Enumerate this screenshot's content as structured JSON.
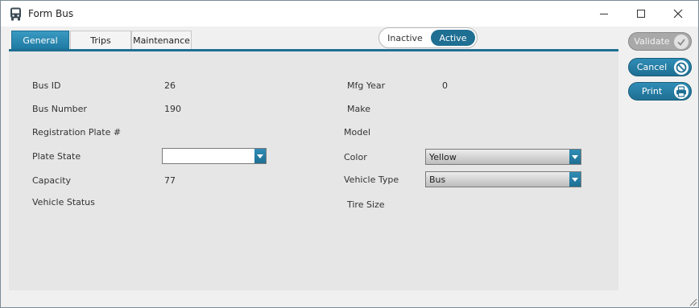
{
  "window": {
    "title": "Form Bus",
    "icons": {
      "app": "bus-icon",
      "minimize": "minimize-icon",
      "maximize": "maximize-icon",
      "close": "close-icon"
    }
  },
  "tabs": [
    {
      "label": "General",
      "active": true
    },
    {
      "label": "Trips",
      "active": false
    },
    {
      "label": "Maintenance",
      "active": false
    }
  ],
  "status_toggle": {
    "inactive_label": "Inactive",
    "active_label": "Active",
    "selected": "Active"
  },
  "actions": {
    "validate_label": "Validate",
    "cancel_label": "Cancel",
    "print_label": "Print",
    "icons": {
      "validate": "check-icon",
      "cancel": "cancel-icon",
      "print": "printer-icon"
    }
  },
  "form": {
    "bus_id": {
      "label": "Bus ID",
      "value": "26"
    },
    "bus_number": {
      "label": "Bus Number",
      "value": "190"
    },
    "registration_plate": {
      "label": "Registration Plate #",
      "value": ""
    },
    "plate_state": {
      "label": "Plate State",
      "value": ""
    },
    "capacity": {
      "label": "Capacity",
      "value": "77"
    },
    "vehicle_status": {
      "label": "Vehicle Status",
      "value": ""
    },
    "mfg_year": {
      "label": "Mfg Year",
      "value": "0"
    },
    "make": {
      "label": "Make",
      "value": ""
    },
    "model": {
      "label": "Model",
      "value": ""
    },
    "color": {
      "label": "Color",
      "value": "Yellow"
    },
    "vehicle_type": {
      "label": "Vehicle Type",
      "value": "Bus"
    },
    "tire_size": {
      "label": "Tire Size",
      "value": ""
    }
  },
  "colors": {
    "accent": "#1f6f93",
    "panel": "#e6e6e6",
    "disabled_button": "#a9a9a9"
  }
}
